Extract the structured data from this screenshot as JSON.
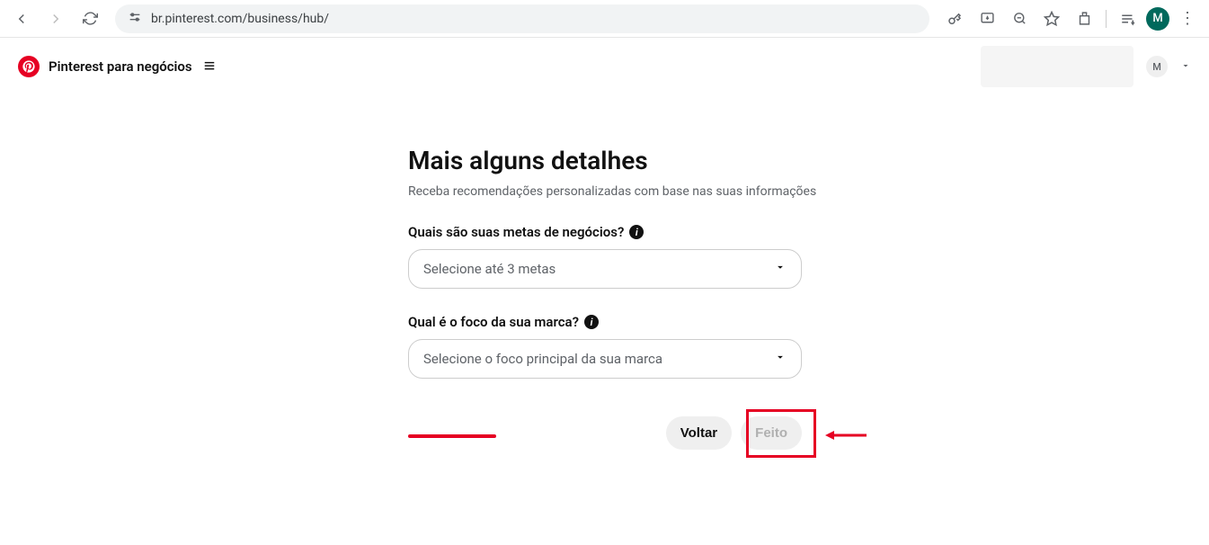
{
  "browser": {
    "url": "br.pinterest.com/business/hub/",
    "profile_initial": "M"
  },
  "header": {
    "brand": "Pinterest para negócios",
    "avatar_initial": "M"
  },
  "main": {
    "title": "Mais alguns detalhes",
    "subtitle": "Receba recomendações personalizadas com base nas suas informações",
    "field1": {
      "label": "Quais são suas metas de negócios?",
      "placeholder": "Selecione até 3 metas"
    },
    "field2": {
      "label": "Qual é o foco da sua marca?",
      "placeholder": "Selecione o foco principal da sua marca"
    },
    "actions": {
      "back": "Voltar",
      "done": "Feito"
    }
  }
}
